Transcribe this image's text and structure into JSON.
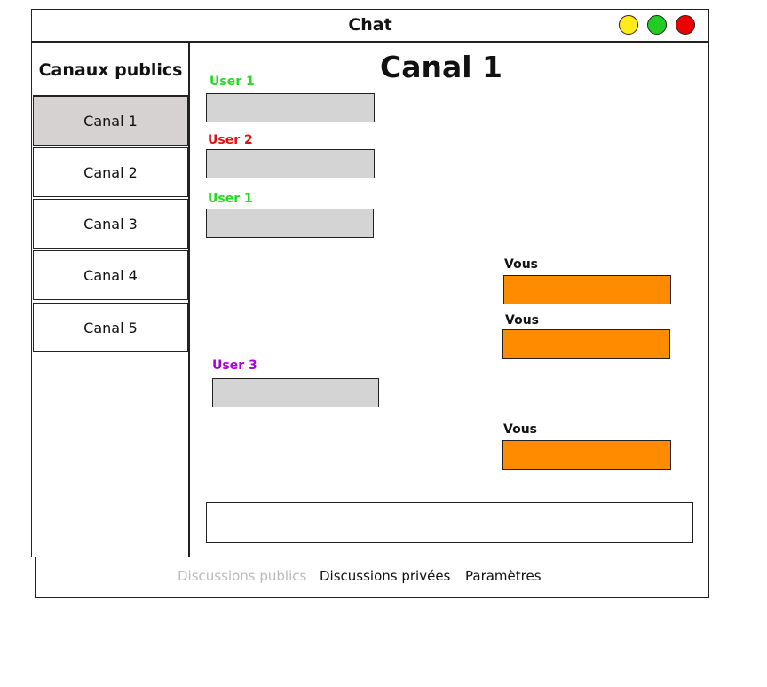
{
  "window": {
    "title": "Chat"
  },
  "colors": {
    "window_buttons": [
      "#ffeb1a",
      "#22cc22",
      "#ee0000"
    ],
    "active_channel_bg": "#d6d2d2",
    "incoming_bubble": "#d4d4d4",
    "outgoing_bubble": "#ff8c00",
    "user1": "#22dd22",
    "user2": "#dd1111",
    "user3": "#aa00dd",
    "nav_inactive": "#bbbbbb"
  },
  "sidebar": {
    "heading": "Canaux publics",
    "channels": [
      {
        "label": "Canal 1"
      },
      {
        "label": "Canal 2"
      },
      {
        "label": "Canal 3"
      },
      {
        "label": "Canal 4"
      },
      {
        "label": "Canal 5"
      }
    ]
  },
  "main": {
    "channel_title": "Canal 1",
    "messages": [
      {
        "sender": "User 1"
      },
      {
        "sender": "User 2"
      },
      {
        "sender": "User 1"
      },
      {
        "sender": "Vous"
      },
      {
        "sender": "Vous"
      },
      {
        "sender": "User 3"
      },
      {
        "sender": "Vous"
      }
    ]
  },
  "nav": {
    "public": "Discussions publics",
    "private": "Discussions privées",
    "settings": "Paramètres"
  }
}
